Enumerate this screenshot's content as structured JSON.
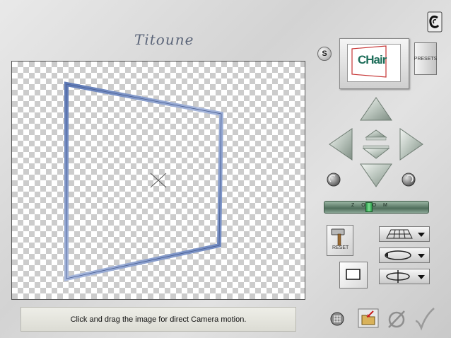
{
  "brand": {
    "name": "Titoune"
  },
  "preview": {
    "text": "CHair"
  },
  "buttons": {
    "s_label": "S",
    "presets_label": "PRESETS",
    "reset_label": "RESET"
  },
  "zoom": {
    "label": "Z O O M",
    "value": 0.42
  },
  "status": {
    "text": "Click and drag the image for direct Camera motion."
  },
  "icons": {
    "logo": "c-logo-icon",
    "nav_up": "arrow-up-icon",
    "nav_down": "arrow-down-icon",
    "nav_left": "arrow-left-icon",
    "nav_right": "arrow-right-icon",
    "move_up": "small-arrow-up-icon",
    "move_down": "small-arrow-down-icon",
    "rotate_left": "rotate-left-icon",
    "rotate_right": "rotate-right-icon",
    "grid": "grid-icon",
    "open_file": "open-folder-icon",
    "cancel": "cancel-icon",
    "ok": "checkmark-icon"
  },
  "colors": {
    "frame": "#6d86bd",
    "arrow_fill": "#c9d2cb",
    "status_bg": "#e4e4dc"
  }
}
